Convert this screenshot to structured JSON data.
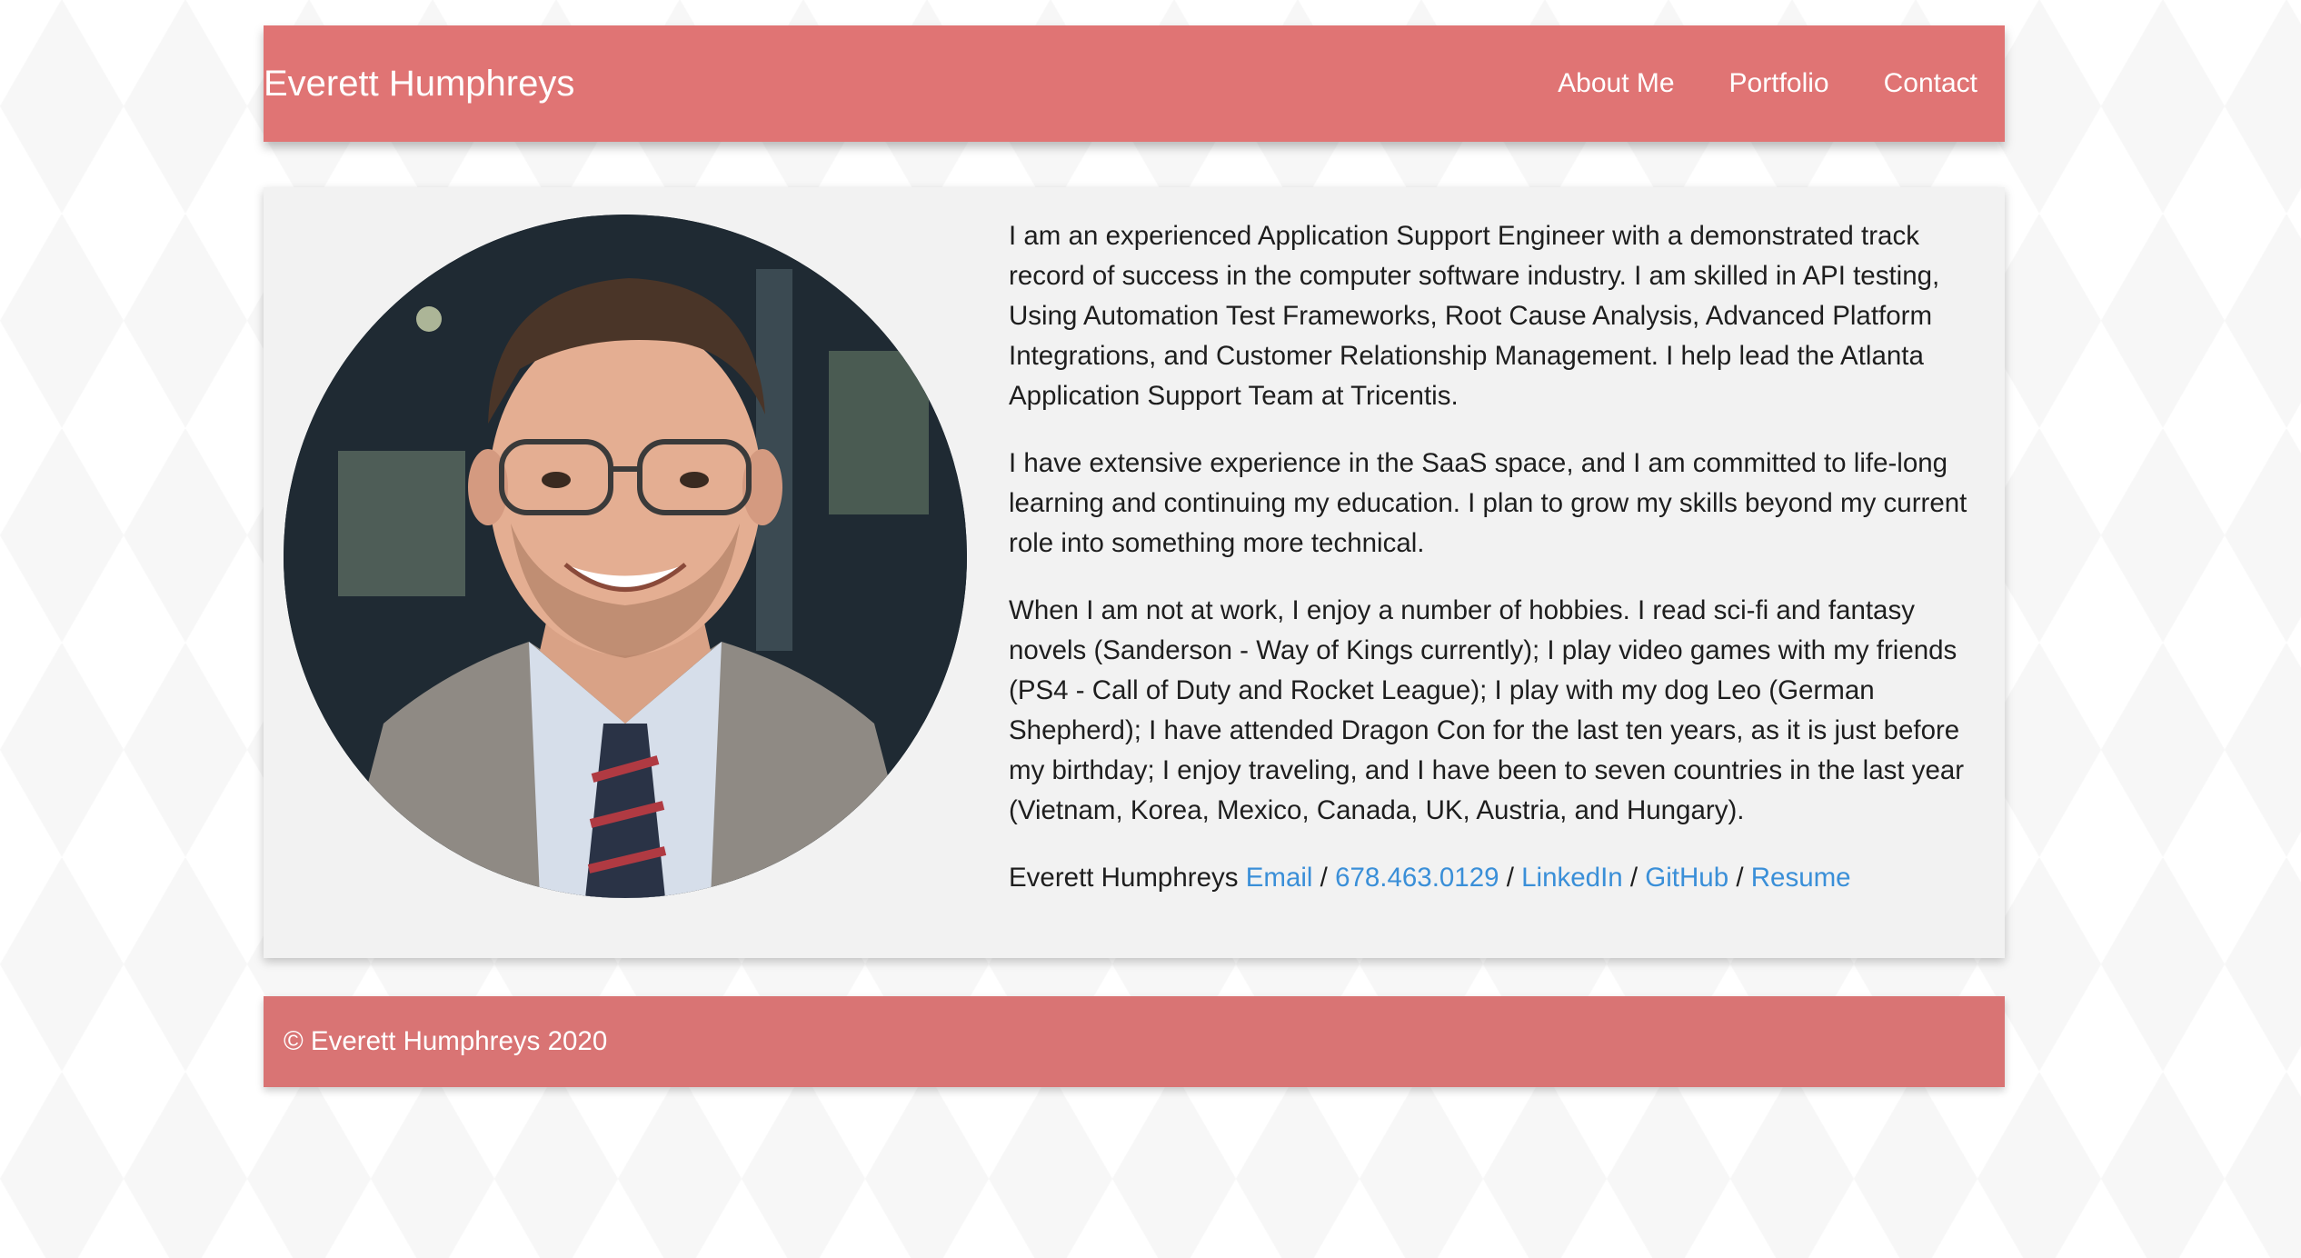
{
  "nav": {
    "brand": "Everett Humphreys",
    "links": [
      "About Me",
      "Portfolio",
      "Contact"
    ]
  },
  "about": {
    "paragraphs": [
      "I am an experienced Application Support Engineer with a demonstrated track record of success in the computer software industry. I am skilled in API testing, Using Automation Test Frameworks, Root Cause Analysis, Advanced Platform Integrations, and Customer Relationship Management. I help lead the Atlanta Application Support Team at Tricentis.",
      "I have extensive experience in the SaaS space, and I am committed to life-long learning and continuing my education. I plan to grow my skills beyond my current role into something more technical.",
      "When I am not at work, I enjoy a number of hobbies. I read sci-fi and fantasy novels (Sanderson - Way of Kings currently); I play video games with my friends (PS4 - Call of Duty and Rocket League); I play with my dog Leo (German Shepherd); I have attended Dragon Con for the last ten years, as it is just before my birthday; I enjoy traveling, and I have been to seven countries in the last year (Vietnam, Korea, Mexico, Canada, UK, Austria, and Hungary)."
    ],
    "contact": {
      "name": "Everett Humphreys",
      "email": "Email",
      "phone": "678.463.0129",
      "linkedin": "LinkedIn",
      "github": "GitHub",
      "resume": "Resume",
      "separator": "/"
    }
  },
  "footer": {
    "text": "© Everett Humphreys 2020"
  },
  "colors": {
    "header": "#e07474",
    "footer": "#d97474",
    "link": "#3a8fd8",
    "card": "#f2f2f2"
  }
}
